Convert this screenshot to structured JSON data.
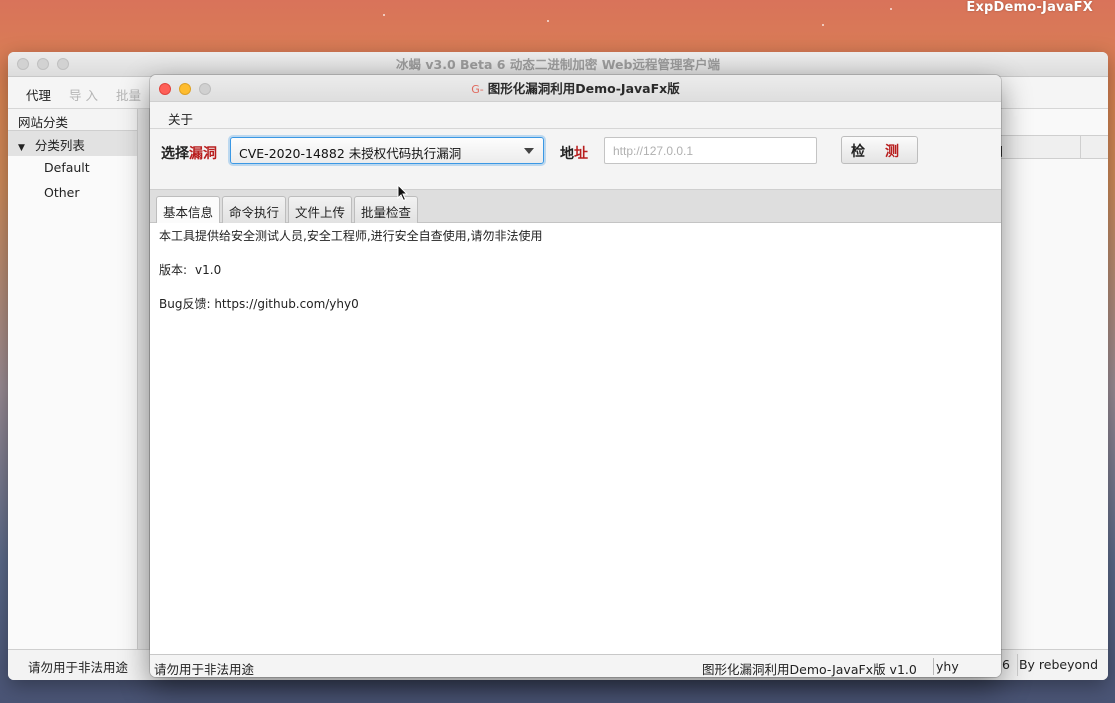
{
  "desktop": {
    "app_name": "ExpDemo-JavaFX"
  },
  "back_window": {
    "title": "冰蝎 v3.0 Beta 6 动态二进制加密 Web远程管理客户端",
    "menu": [
      "代理",
      "导 入",
      "批量"
    ],
    "sidebar_header": "网站分类",
    "tree": {
      "root": "分类列表",
      "children": [
        "Default",
        "Other"
      ]
    },
    "column_header": "时间",
    "status_left": "请勿用于非法用途",
    "status_num": "6",
    "status_right": "By rebeyond"
  },
  "front_window": {
    "title": "图形化漏洞利用Demo-JavaFx版",
    "title_icon": "G-",
    "menu": {
      "about": "关于"
    },
    "select_label_a": "选择",
    "select_label_b": "漏洞",
    "vuln_selected": "CVE-2020-14882 未授权代码执行漏洞",
    "addr_label_a": "地",
    "addr_label_b": "址",
    "addr_placeholder": "http://127.0.0.1",
    "detect_a": "检",
    "detect_b": "测",
    "tabs": [
      "基本信息",
      "命令执行",
      "文件上传",
      "批量检查"
    ],
    "info": {
      "line1": "本工具提供给安全测试人员,安全工程师,进行安全自查使用,请勿非法使用",
      "version_label": "版本:",
      "version_value": "v1.0",
      "bug_line": "Bug反馈: https://github.com/yhy0"
    },
    "status_left": "请勿用于非法用途",
    "status_mid": "图形化漏洞利用Demo-JavaFx版 v1.0",
    "status_right": "yhy"
  },
  "colors": {
    "accent_red": "#b81e1e",
    "focus_blue": "#3b98e4"
  }
}
